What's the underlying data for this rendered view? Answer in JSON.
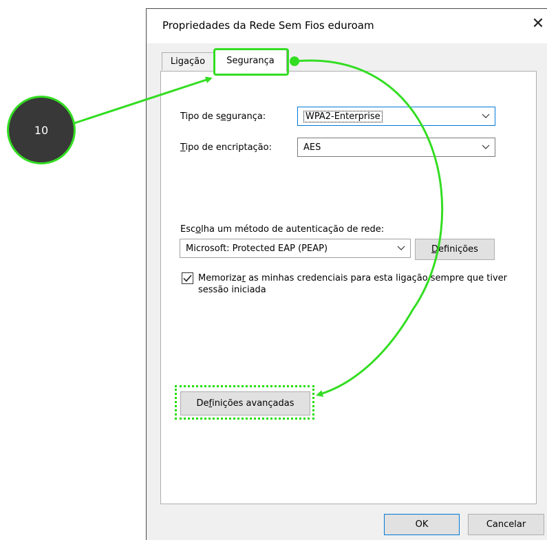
{
  "dialog": {
    "title": "Propriedades da Rede Sem Fios eduroam",
    "close_icon": "close-icon"
  },
  "tabs": [
    {
      "label": "Ligação",
      "selected": false
    },
    {
      "label": "Segurança",
      "selected": true
    }
  ],
  "security": {
    "type_label_pre": "Tipo de s",
    "type_label_u": "e",
    "type_label_post": "gurança:",
    "type_value": "WPA2-Enterprise",
    "enc_label_u": "T",
    "enc_label_post": "ipo de encriptação:",
    "enc_value": "AES"
  },
  "auth": {
    "label_pre": "Esc",
    "label_u": "o",
    "label_post": "lha um método de autenticação de rede:",
    "method_value": "Microsoft: Protected EAP (PEAP)",
    "settings_u": "D",
    "settings_post": "efinições"
  },
  "remember": {
    "checked": true,
    "label_pre": "Memoriza",
    "label_u": "r",
    "label_post": " as minhas credenciais para esta ligação sempre que tiver sessão iniciada"
  },
  "advanced": {
    "label_pre": "De",
    "label_u": "f",
    "label_post": "inições avançadas"
  },
  "footer": {
    "ok_label": "OK",
    "cancel_label": "Cancelar"
  },
  "annotation": {
    "step_number": "10",
    "highlight_color": "#33dd22"
  }
}
